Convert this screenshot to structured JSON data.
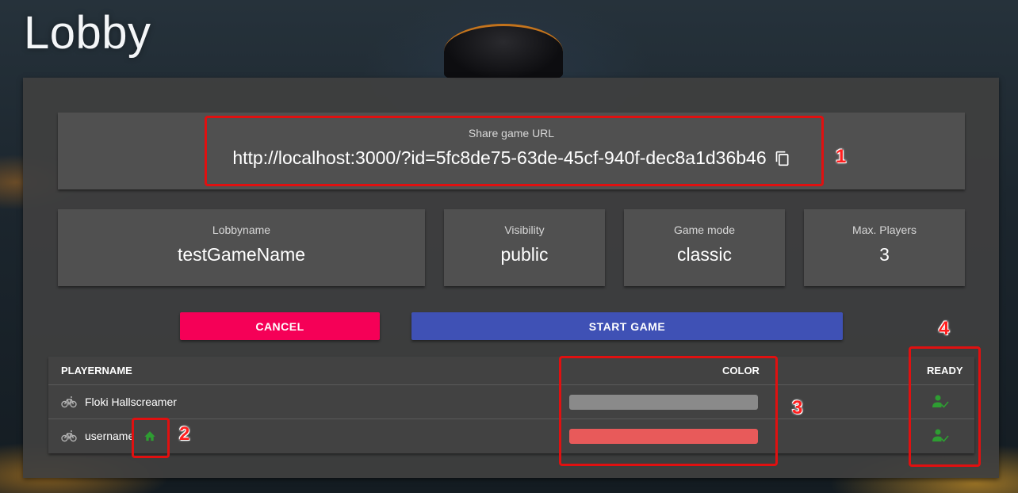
{
  "page": {
    "title": "Lobby"
  },
  "share": {
    "label": "Share game URL",
    "url": "http://localhost:3000/?id=5fc8de75-63de-45cf-940f-dec8a1d36b46",
    "copy_icon": "copy-icon"
  },
  "info": {
    "lobbyname": {
      "label": "Lobbyname",
      "value": "testGameName"
    },
    "visibility": {
      "label": "Visibility",
      "value": "public"
    },
    "game_mode": {
      "label": "Game mode",
      "value": "classic"
    },
    "max_players": {
      "label": "Max. Players",
      "value": "3"
    }
  },
  "buttons": {
    "cancel": "CANCEL",
    "start": "START GAME"
  },
  "table": {
    "headers": {
      "player": "PLAYERNAME",
      "color": "COLOR",
      "ready": "READY"
    },
    "rows": [
      {
        "name": "Floki Hallscreamer",
        "icon": "bike-icon",
        "host": false,
        "color": "#8a8a8a",
        "ready": true
      },
      {
        "name": "username",
        "icon": "bike-icon",
        "host": true,
        "color": "#e85a5a",
        "ready": true
      }
    ]
  },
  "annotations": [
    "1",
    "2",
    "3",
    "4"
  ],
  "colors": {
    "cancel": "#f50057",
    "start": "#3f51b5",
    "ready": "#2e9d32",
    "annotation": "#e01010"
  }
}
